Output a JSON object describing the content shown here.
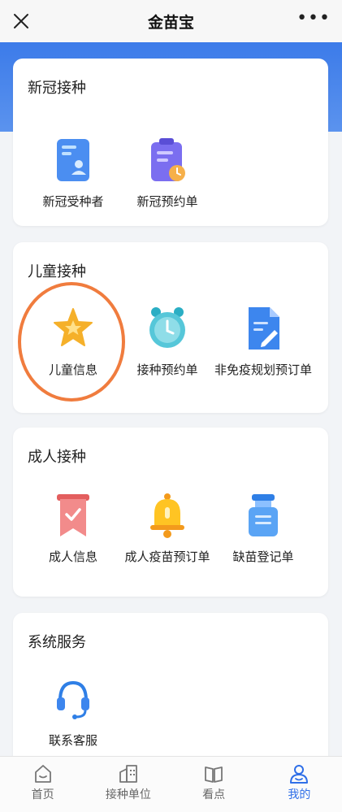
{
  "header": {
    "title": "金苗宝",
    "more": "•••"
  },
  "sections": [
    {
      "title": "新冠接种",
      "items": [
        {
          "label": "新冠受种者",
          "icon": "person-card-icon"
        },
        {
          "label": "新冠预约单",
          "icon": "clipboard-clock-icon"
        }
      ]
    },
    {
      "title": "儿童接种",
      "items": [
        {
          "label": "儿童信息",
          "icon": "star-icon"
        },
        {
          "label": "接种预约单",
          "icon": "alarm-clock-icon"
        },
        {
          "label": "非免疫规划预订单",
          "icon": "document-edit-icon"
        }
      ]
    },
    {
      "title": "成人接种",
      "items": [
        {
          "label": "成人信息",
          "icon": "ribbon-check-icon"
        },
        {
          "label": "成人疫苗预订单",
          "icon": "bell-icon"
        },
        {
          "label": "缺苗登记单",
          "icon": "vial-icon"
        }
      ]
    },
    {
      "title": "系统服务",
      "items": [
        {
          "label": "联系客服",
          "icon": "headset-icon"
        }
      ]
    }
  ],
  "tabbar": [
    {
      "label": "首页",
      "icon": "home-icon",
      "active": false
    },
    {
      "label": "接种单位",
      "icon": "building-icon",
      "active": false
    },
    {
      "label": "看点",
      "icon": "book-icon",
      "active": false
    },
    {
      "label": "我的",
      "icon": "user-icon",
      "active": true
    }
  ],
  "colors": {
    "accent": "#2f6fe8",
    "highlight_ring": "#f07c3e",
    "header_band": "#3c7be9"
  }
}
